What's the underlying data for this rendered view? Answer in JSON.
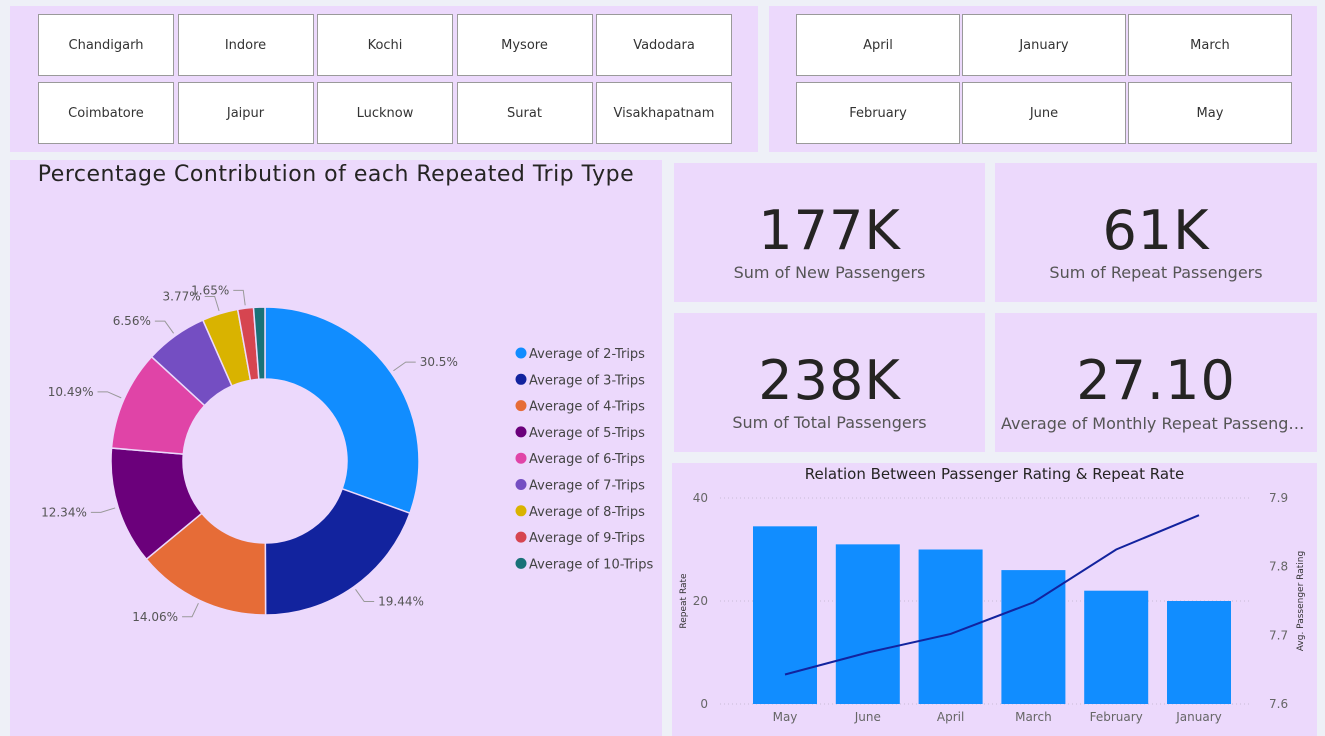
{
  "city_slicer": {
    "items": [
      "Chandigarh",
      "Indore",
      "Kochi",
      "Mysore",
      "Vadodara",
      "Coimbatore",
      "Jaipur",
      "Lucknow",
      "Surat",
      "Visakhapatnam"
    ]
  },
  "month_slicer": {
    "items": [
      "April",
      "January",
      "March",
      "February",
      "June",
      "May"
    ]
  },
  "cards": [
    {
      "value": "177K",
      "label": "Sum of New Passengers"
    },
    {
      "value": "61K",
      "label": "Sum of Repeat Passengers"
    },
    {
      "value": "238K",
      "label": "Sum of Total Passengers"
    },
    {
      "value": "27.10",
      "label": "Average of Monthly Repeat Passenger R..."
    }
  ],
  "colors": {
    "panel_bg": "#ecd9fc",
    "bar": "#118dff",
    "line": "#12239e"
  },
  "chart_data": [
    {
      "type": "pie",
      "donut": true,
      "title": "Percentage Contribution of each Repeated Trip Type",
      "legend_position": "right",
      "labels": [
        "Average of 2-Trips",
        "Average of 3-Trips",
        "Average of 4-Trips",
        "Average of 5-Trips",
        "Average of 6-Trips",
        "Average of 7-Trips",
        "Average of 8-Trips",
        "Average of 9-Trips",
        "Average of 10-Trips"
      ],
      "values": [
        30.5,
        19.44,
        14.06,
        12.34,
        10.49,
        6.56,
        3.77,
        1.65,
        1.19
      ],
      "data_labels": [
        "30.5%",
        "19.44%",
        "14.06%",
        "12.34%",
        "10.49%",
        "6.56%",
        "3.77%",
        "1.65%",
        ""
      ],
      "colors": [
        "#118dff",
        "#12239e",
        "#e66c37",
        "#6b007b",
        "#e044a7",
        "#744ec2",
        "#d9b300",
        "#d64550",
        "#197278"
      ]
    },
    {
      "type": "bar",
      "combo": "bar+line",
      "title": "Relation Between Passenger Rating & Repeat Rate",
      "categories": [
        "May",
        "June",
        "April",
        "March",
        "February",
        "January"
      ],
      "series": [
        {
          "values": [
            34.5,
            31.0,
            30.0,
            26.0,
            22.0,
            20.0
          ],
          "axis": "left",
          "type": "bar"
        },
        {
          "values": [
            7.643,
            7.675,
            7.702,
            7.748,
            7.825,
            7.875
          ],
          "axis": "right",
          "type": "line"
        }
      ],
      "ylabel": "Repeat Rate",
      "ylabel_right": "Avg. Passenger Rating",
      "ylim": [
        0,
        40
      ],
      "yticks": [
        "0",
        "20",
        "40"
      ],
      "ylim_right": [
        7.6,
        7.9
      ],
      "yticks_right": [
        "7.6",
        "7.7",
        "7.8",
        "7.9"
      ],
      "grid": true
    }
  ]
}
